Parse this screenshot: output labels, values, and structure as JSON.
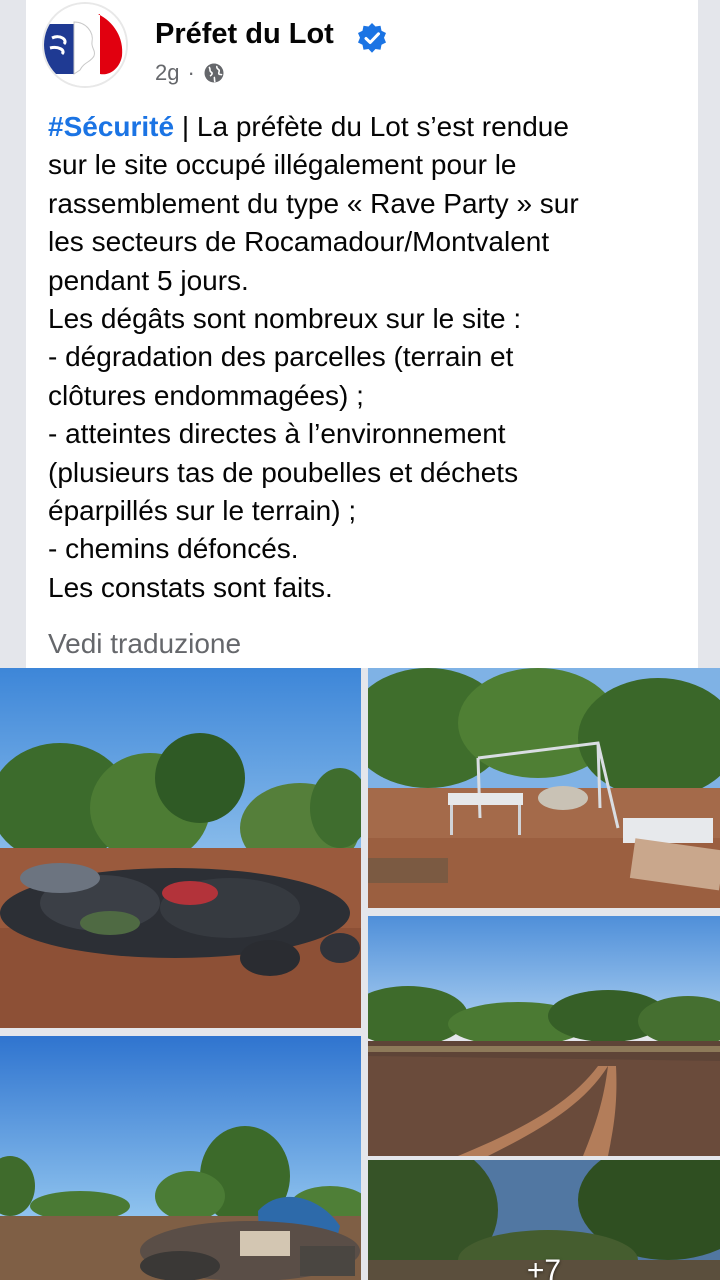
{
  "post": {
    "author": "Préfet du Lot",
    "time": "2g",
    "hashtag": "#Sécurité",
    "body": " | La préfète du Lot s’est rendue\nsur le site occupé illégalement pour le\nrassemblement du type « Rave Party » sur\nles secteurs de Rocamadour/Montvalent\npendant 5 jours.\nLes dégâts sont nombreux sur le site :\n- dégradation des parcelles (terrain et\nclôtures endommagées) ;\n- atteintes directes à l’environnement\n(plusieurs tas de poubelles et déchets\néparpillés sur le terrain) ;\n- chemins défoncés.\nLes constats sont faits.",
    "translate_label": "Vedi traduzione"
  },
  "photos": {
    "more_count": "+7"
  },
  "icons": {
    "avatar": "marianne-logo",
    "verified": "verified-badge-icon",
    "audience": "globe-icon"
  },
  "colors": {
    "verified_blue": "#1b74e4",
    "hashtag_blue": "#1b74e4",
    "meta_gray": "#65676b"
  }
}
